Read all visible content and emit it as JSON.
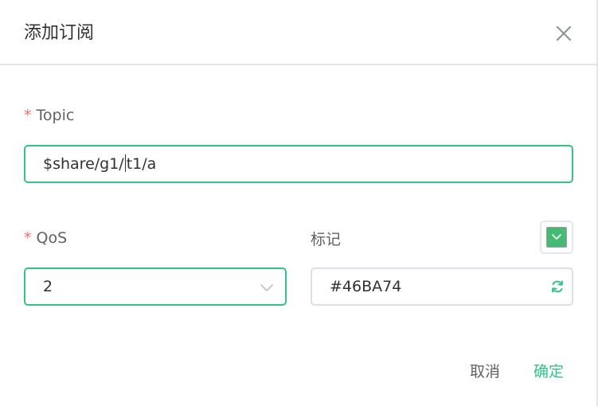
{
  "dialog": {
    "title": "添加订阅",
    "close_icon": "close-icon"
  },
  "topic": {
    "required_mark": "*",
    "label": "Topic",
    "value_before_caret": "$share/g1/",
    "value_after_caret": "t1/a"
  },
  "qos": {
    "required_mark": "*",
    "label": "QoS",
    "value": "2",
    "icon": "chevron-down-icon"
  },
  "tag": {
    "label": "标记",
    "value": "#46BA74",
    "swatch_color": "#46BA74",
    "icon": "refresh-icon"
  },
  "footer": {
    "cancel_label": "取消",
    "confirm_label": "确定"
  },
  "colors": {
    "accent": "#34C388",
    "required": "#F56C6C"
  }
}
